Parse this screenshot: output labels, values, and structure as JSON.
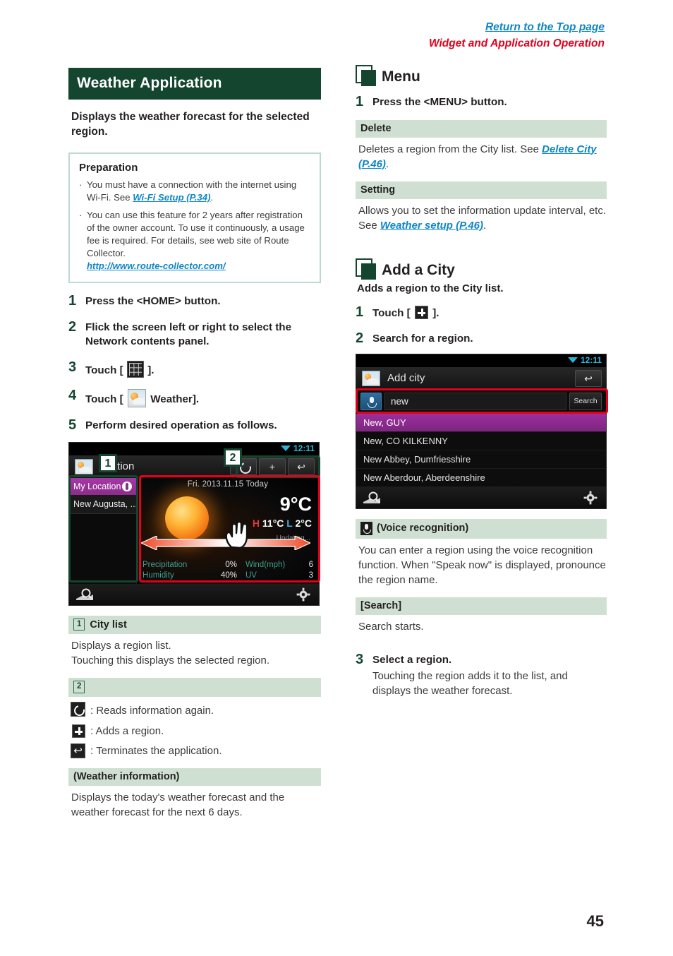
{
  "header": {
    "return_link": "Return to the Top page",
    "section_link": "Widget and Application Operation"
  },
  "left": {
    "title": "Weather Application",
    "intro": "Displays the weather forecast for the selected region.",
    "preparation": {
      "heading": "Preparation",
      "items": [
        {
          "text_before": "You must have a connection with the internet using Wi-Fi. See ",
          "link": "Wi-Fi Setup (P.34)",
          "text_after": "."
        },
        {
          "text_before": "You can use this feature for 2 years after registration of the owner account. To use it continuously, a usage fee is required. For details, see web site of Route Collector.",
          "link": "http://www.route-collector.com/",
          "text_after": ""
        }
      ]
    },
    "steps": [
      {
        "n": "1",
        "text": "Press the <HOME> button."
      },
      {
        "n": "2",
        "text": "Flick the screen left or right to select the Network contents panel."
      },
      {
        "n": "3",
        "text_before": "Touch [",
        "icon": "grid-icon",
        "text_after": "]."
      },
      {
        "n": "4",
        "text_before": "Touch [",
        "icon": "weather-icon",
        "text_mid": "Weather]."
      },
      {
        "n": "5",
        "text": "Perform desired operation as follows."
      }
    ],
    "sections": [
      {
        "callout": "1",
        "heading": "City list",
        "lines": [
          "Displays a region list.",
          "Touching this displays the selected region."
        ]
      },
      {
        "callout": "2",
        "heading": "",
        "legend": [
          {
            "icon": "refresh-icon",
            "text": ": Reads information again."
          },
          {
            "icon": "plus-icon",
            "text": ": Adds a region."
          },
          {
            "icon": "back-icon",
            "text": ": Terminates the application."
          }
        ]
      },
      {
        "heading": "(Weather information)",
        "lines": [
          "Displays the today's weather forecast and the weather forecast for the next 6 days."
        ]
      }
    ]
  },
  "weather_screen": {
    "clock": "12:11",
    "app_title": "ocation",
    "tools": {
      "refresh": "",
      "add": "+",
      "back": "↩"
    },
    "city_list": {
      "header": "My Location",
      "items": [
        "New Augusta, ..."
      ]
    },
    "forecast": {
      "date": "Fri. 2013.11.15 Today",
      "temp": "9°C",
      "high_label": "H",
      "high": "11°C",
      "low_label": "L",
      "low": "2°C",
      "updating": "Updating...",
      "rows": [
        {
          "label": "Precipitation",
          "value": "0%",
          "label2": "Wind(mph)",
          "value2": "6"
        },
        {
          "label": "Humidity",
          "value": "40%",
          "label2": "UV",
          "value2": "3"
        }
      ]
    },
    "annotations": {
      "tag1": "1",
      "tag2": "2"
    }
  },
  "right": {
    "menu": {
      "heading": "Menu",
      "step": {
        "n": "1",
        "text": "Press the <MENU> button."
      },
      "sections": [
        {
          "heading": "Delete",
          "text_before": "Deletes a region from the City list. See ",
          "link": "Delete City (P.46)",
          "text_after": "."
        },
        {
          "heading": "Setting",
          "text_before": "Allows you to set the information update interval, etc.  See ",
          "link": "Weather setup (P.46)",
          "text_after": "."
        }
      ]
    },
    "add_city": {
      "heading": "Add a City",
      "subtitle": "Adds a region to the City list.",
      "step1_before": "Touch [",
      "step1_icon": "plus-icon",
      "step1_after": "].",
      "step1_n": "1",
      "step2_n": "2",
      "step2": "Search for a region.",
      "voice": {
        "heading": "(Voice recognition)",
        "text": "You can enter a region using the voice recognition function. When \"Speak now\" is displayed, pronounce the region name."
      },
      "search": {
        "heading": "[Search]",
        "text": "Search starts."
      },
      "step3_n": "3",
      "step3_title": "Select a region.",
      "step3_text": "Touching the region adds it to the list, and displays the weather forecast."
    }
  },
  "addcity_screen": {
    "clock": "12:11",
    "title": "Add city",
    "back_icon": "↩",
    "search_value": "new",
    "search_button": "Search",
    "results": [
      "New, GUY",
      "New, CO KILKENNY",
      "New Abbey, Dumfriesshire",
      "New Aberdour, Aberdeenshire"
    ]
  },
  "page_number": "45",
  "colors": {
    "title_bar": "#14452f",
    "section_bar": "#cfe0d3",
    "link_blue": "#0e86c8",
    "link_red": "#e2001a",
    "anno_green": "#14452f",
    "anno_red": "#e2001a"
  }
}
